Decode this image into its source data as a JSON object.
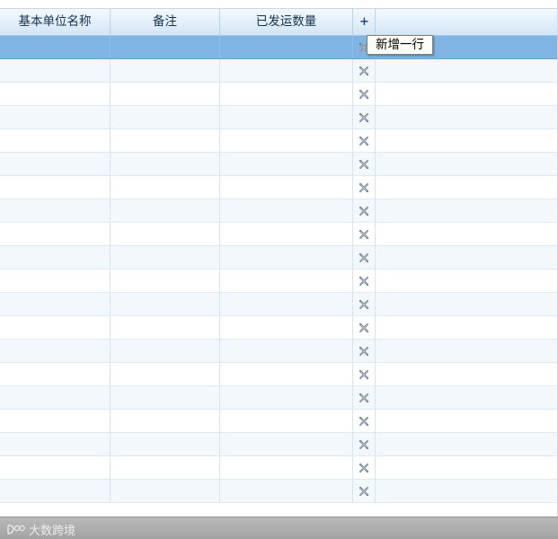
{
  "grid": {
    "columns": [
      {
        "key": "base_unit_name",
        "label": "基本单位名称"
      },
      {
        "key": "remark",
        "label": "备注"
      },
      {
        "key": "shipped_qty",
        "label": "已发运数量"
      }
    ],
    "add_button_label": "+",
    "add_row_tooltip": "新增一行",
    "row_count": 20,
    "selected_row": 0,
    "delete_icon": "delete-x-icon"
  },
  "watermark": {
    "text": "大数跨境"
  },
  "colors": {
    "header_bg": "#e2eefa",
    "selected_row": "#7fb4e3",
    "alt_row": "#f3f8fd",
    "footer": "#ababab"
  }
}
